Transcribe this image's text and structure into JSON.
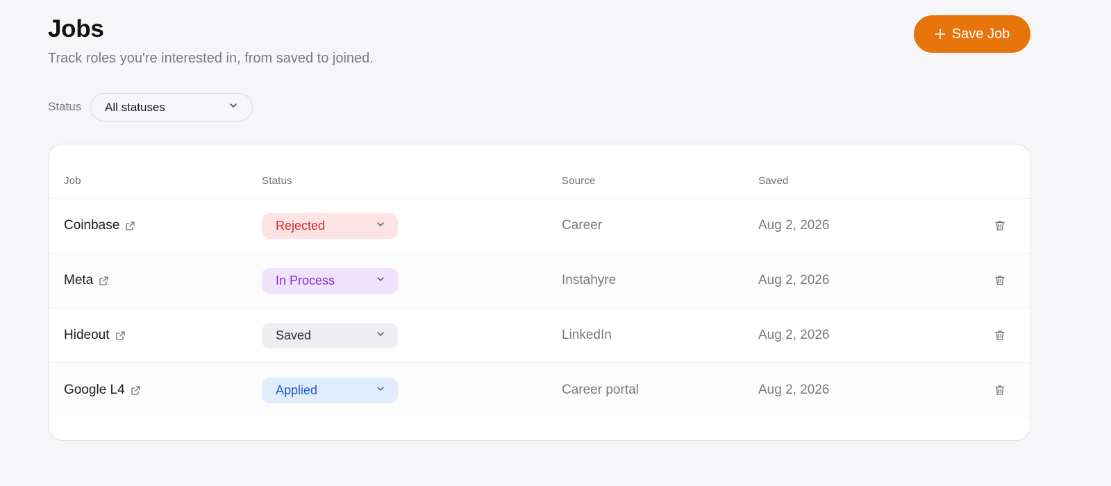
{
  "header": {
    "title": "Jobs",
    "subtitle": "Track roles you're interested in, from saved to joined.",
    "save_button": {
      "label": "Save Job",
      "icon": "plus-icon"
    }
  },
  "filter": {
    "label": "Status",
    "selected": "All statuses",
    "icon": "chevron-down-icon"
  },
  "table": {
    "columns": [
      "Job",
      "Status",
      "Source",
      "Saved"
    ],
    "rows": [
      {
        "job": "Coinbase",
        "status": "Rejected",
        "source": "Career",
        "saved": "Aug 2, 2026"
      },
      {
        "job": "Meta",
        "status": "In Process",
        "source": "Instahyre",
        "saved": "Aug 2, 2026"
      },
      {
        "job": "Hideout",
        "status": "Saved",
        "source": "LinkedIn",
        "saved": "Aug 2, 2026"
      },
      {
        "job": "Google L4",
        "status": "Applied",
        "source": "Career portal",
        "saved": "Aug 2, 2026"
      }
    ]
  },
  "status_colors": {
    "Rejected": {
      "bg": "#fde4e4",
      "fg": "#d42a2a"
    },
    "In Process": {
      "bg": "#f1e3fd",
      "fg": "#8a2fd6"
    },
    "Saved": {
      "bg": "#eeeff2",
      "fg": "#2e2e33"
    },
    "Applied": {
      "bg": "#e1edfd",
      "fg": "#2156d8"
    }
  },
  "colors": {
    "accent": "#e8740c",
    "background": "#f6f6f8"
  },
  "icons": {
    "external_link": "external-link-icon",
    "delete": "trash-icon"
  }
}
